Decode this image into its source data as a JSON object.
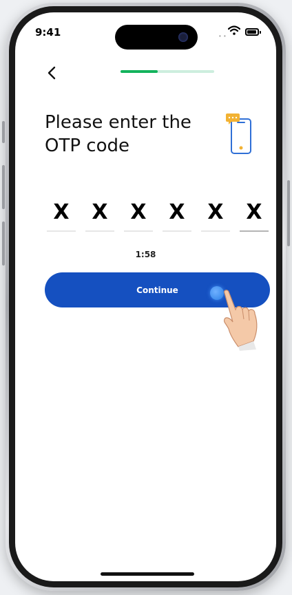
{
  "status_bar": {
    "time": "9:41",
    "signal_icon": "signal-dots-icon",
    "wifi_icon": "wifi-icon",
    "battery_icon": "battery-icon"
  },
  "header": {
    "back_icon": "chevron-left-icon",
    "back_label": "<",
    "progress": 0.4
  },
  "content": {
    "title": "Please enter the OTP code",
    "illustration_icon": "phone-message-icon",
    "otp_digits": [
      "X",
      "X",
      "X",
      "X",
      "X",
      "X"
    ],
    "timer": "1:58"
  },
  "actions": {
    "continue_label": "Continue"
  },
  "colors": {
    "primary": "#1550c0",
    "progress": "#13b35c",
    "progress_track": "#cdeede",
    "icon_outline": "#2f6fd6",
    "icon_bubble": "#f2b233"
  }
}
